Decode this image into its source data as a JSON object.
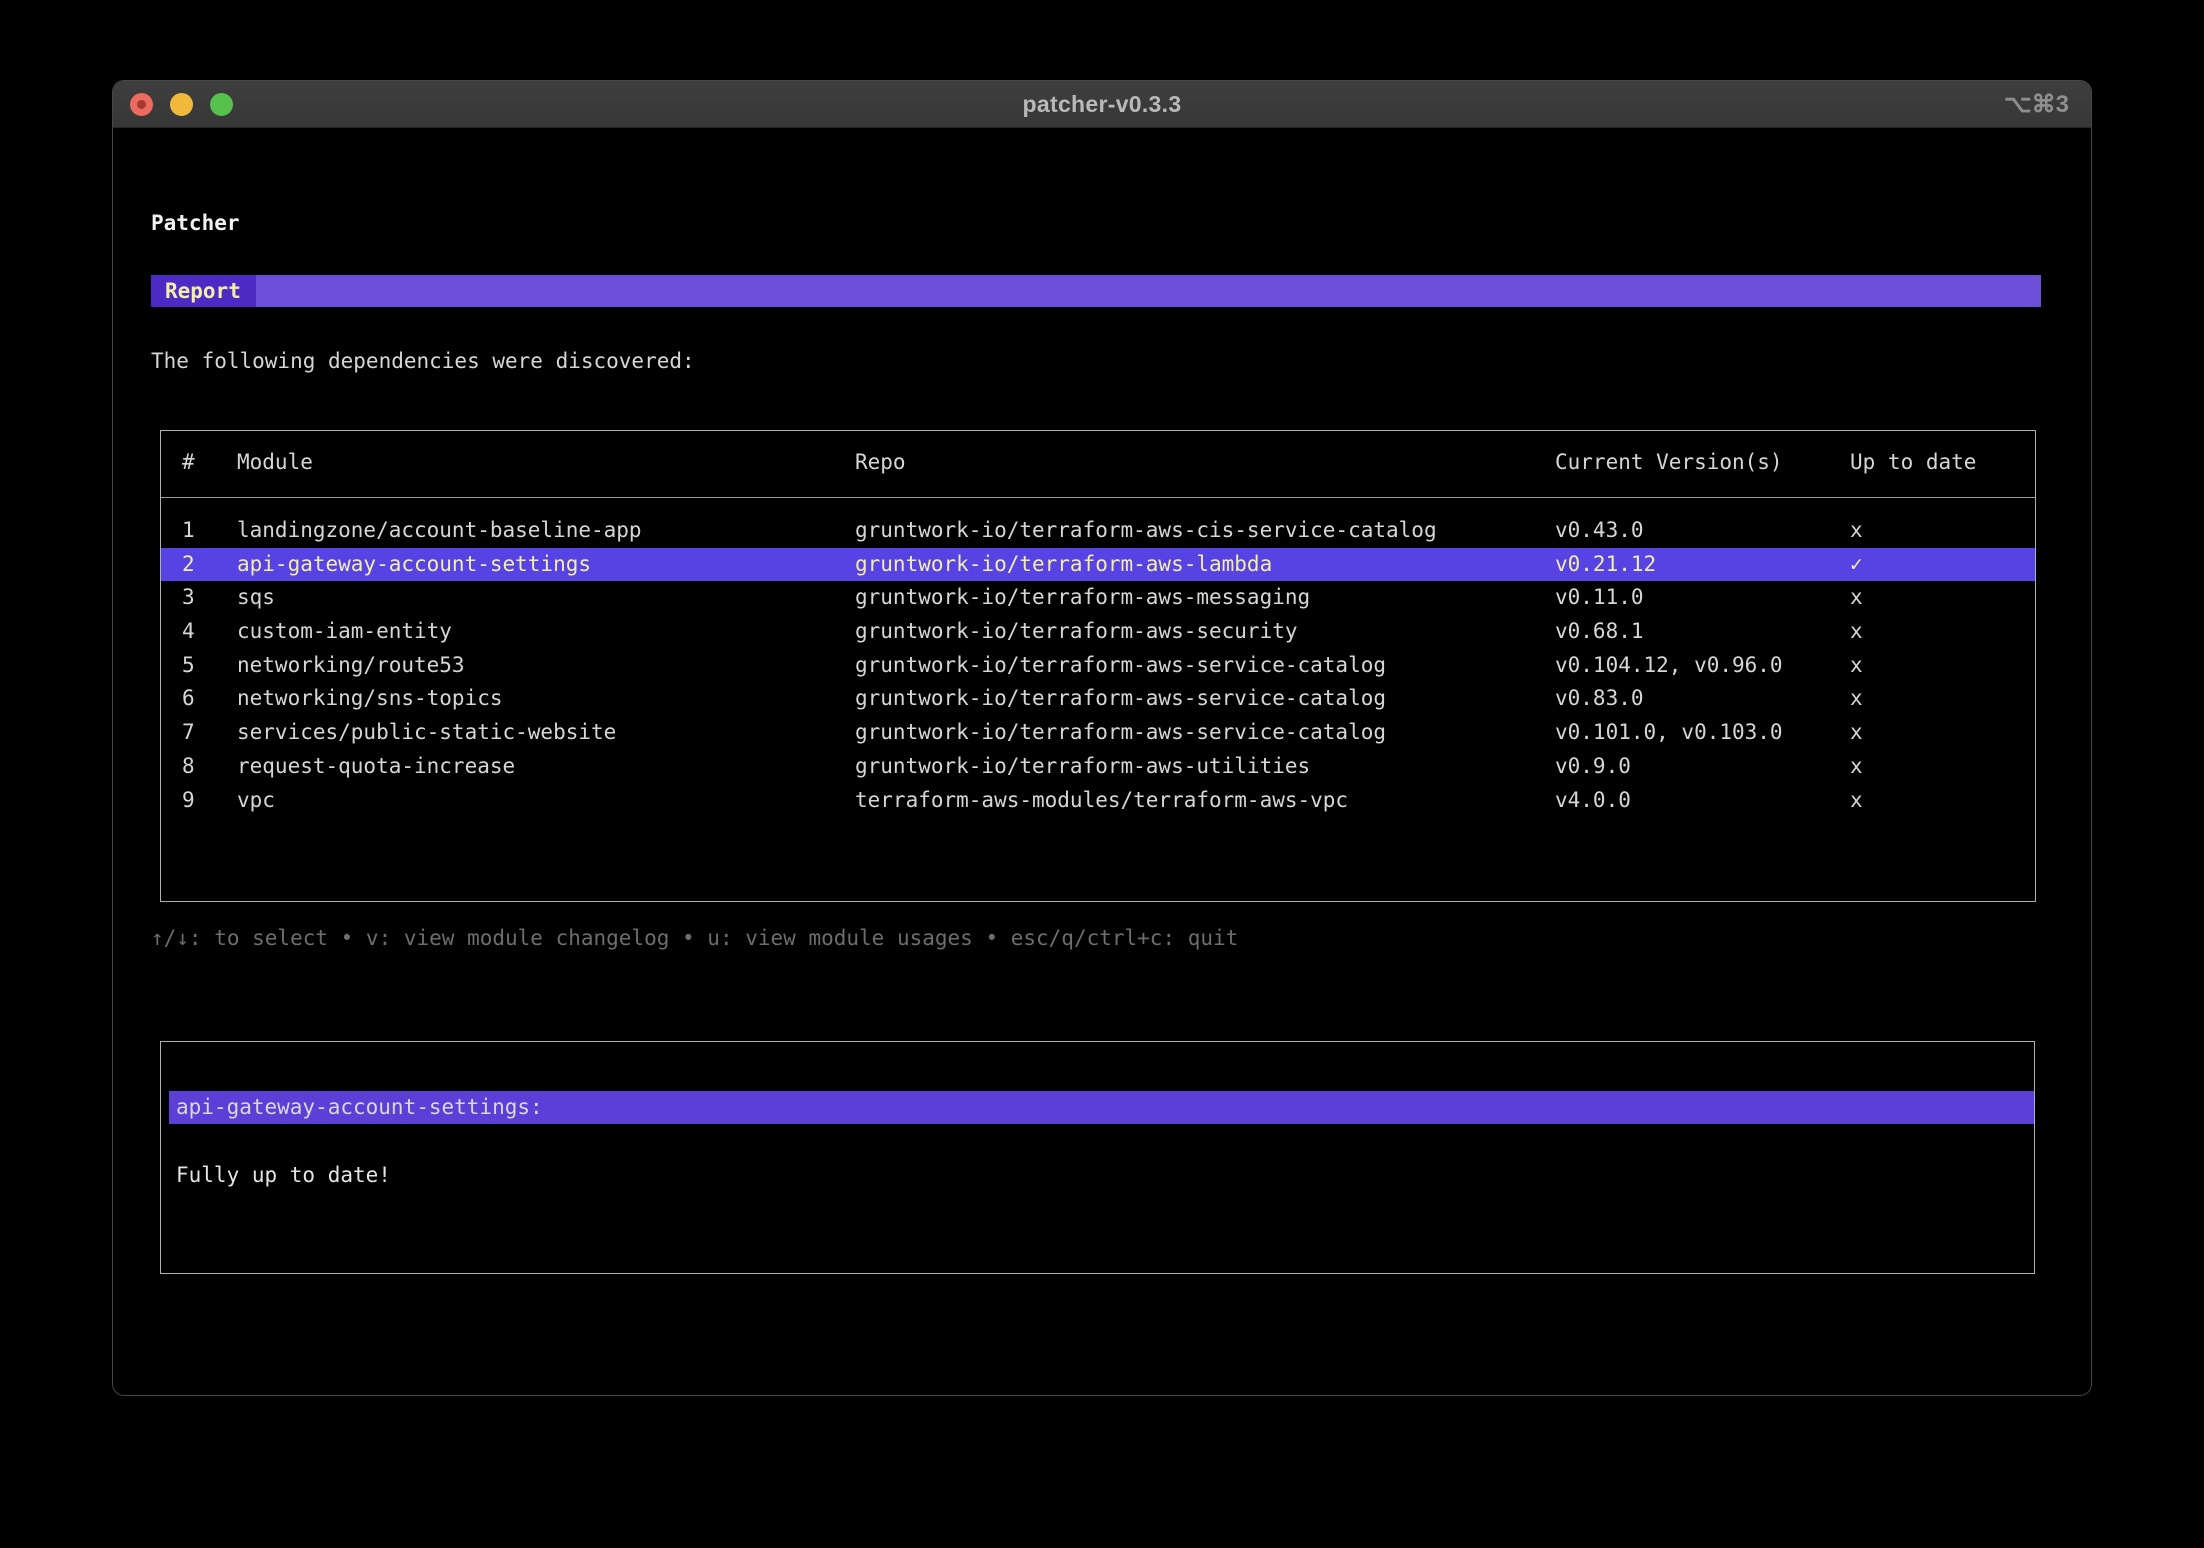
{
  "window": {
    "title": "patcher-v0.3.3",
    "shortcut": "⌥⌘3"
  },
  "app": {
    "heading": "Patcher",
    "tab_label": "Report",
    "intro": "The following dependencies were discovered:",
    "help": "↑/↓: to select • v: view module changelog • u: view module usages • esc/q/ctrl+c: quit"
  },
  "table": {
    "columns": [
      "#",
      "Module",
      "Repo",
      "Current Version(s)",
      "Up to date"
    ],
    "rows": [
      {
        "num": "1",
        "module": "landingzone/account-baseline-app",
        "repo": "gruntwork-io/terraform-aws-cis-service-catalog",
        "versions": "v0.43.0",
        "up_to_date": "x",
        "selected": false
      },
      {
        "num": "2",
        "module": "api-gateway-account-settings",
        "repo": "gruntwork-io/terraform-aws-lambda",
        "versions": "v0.21.12",
        "up_to_date": "✓",
        "selected": true
      },
      {
        "num": "3",
        "module": "sqs",
        "repo": "gruntwork-io/terraform-aws-messaging",
        "versions": "v0.11.0",
        "up_to_date": "x",
        "selected": false
      },
      {
        "num": "4",
        "module": "custom-iam-entity",
        "repo": "gruntwork-io/terraform-aws-security",
        "versions": "v0.68.1",
        "up_to_date": "x",
        "selected": false
      },
      {
        "num": "5",
        "module": "networking/route53",
        "repo": "gruntwork-io/terraform-aws-service-catalog",
        "versions": "v0.104.12, v0.96.0",
        "up_to_date": "x",
        "selected": false
      },
      {
        "num": "6",
        "module": "networking/sns-topics",
        "repo": "gruntwork-io/terraform-aws-service-catalog",
        "versions": "v0.83.0",
        "up_to_date": "x",
        "selected": false
      },
      {
        "num": "7",
        "module": "services/public-static-website",
        "repo": "gruntwork-io/terraform-aws-service-catalog",
        "versions": "v0.101.0, v0.103.0",
        "up_to_date": "x",
        "selected": false
      },
      {
        "num": "8",
        "module": "request-quota-increase",
        "repo": "gruntwork-io/terraform-aws-utilities",
        "versions": "v0.9.0",
        "up_to_date": "x",
        "selected": false
      },
      {
        "num": "9",
        "module": "vpc",
        "repo": "terraform-aws-modules/terraform-aws-vpc",
        "versions": "v4.0.0",
        "up_to_date": "x",
        "selected": false
      }
    ]
  },
  "detail": {
    "title": "api-gateway-account-settings:",
    "body": "Fully up to date!"
  },
  "colors": {
    "accent_banner": "#6b4fd8",
    "accent_tag": "#4e2ac4",
    "accent_row_selected": "#5743e3",
    "accent_detail_bar": "#5c3fd6",
    "selected_text": "#f2edaa",
    "text": "#d6d6d6",
    "muted": "#6d6d6d",
    "border": "#b0b0b0"
  }
}
